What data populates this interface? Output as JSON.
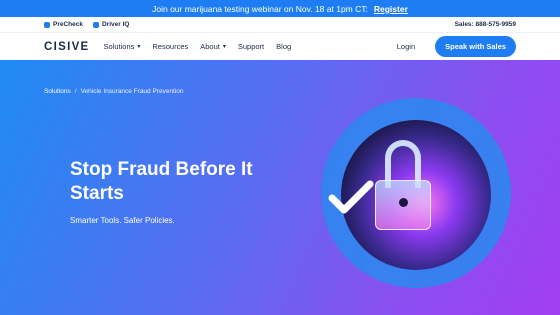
{
  "announcement": {
    "text": "Join our marijuana testing webinar on Nov. 18 at 1pm CT:",
    "link": "Register"
  },
  "utility": {
    "brand1": "PreCheck",
    "brand2": "Driver IQ",
    "sales": "Sales: 888-575-9959"
  },
  "nav": {
    "logo": "CISIVE",
    "items": [
      "Solutions",
      "Resources",
      "About",
      "Support",
      "Blog"
    ],
    "login": "Login",
    "cta": "Speak with Sales"
  },
  "breadcrumb": {
    "parent": "Solutions",
    "separator": "/",
    "current": "Vehicle Insurance Fraud Prevention"
  },
  "hero": {
    "title": "Stop Fraud Before It Starts",
    "subtitle": "Smarter Tools. Safer Policies."
  },
  "colors": {
    "accent": "#1e7df2",
    "gradient_start": "#1f8bf3",
    "gradient_end": "#a23ef2"
  },
  "icons": [
    "chevron-down-icon",
    "check-icon",
    "lock-icon"
  ]
}
